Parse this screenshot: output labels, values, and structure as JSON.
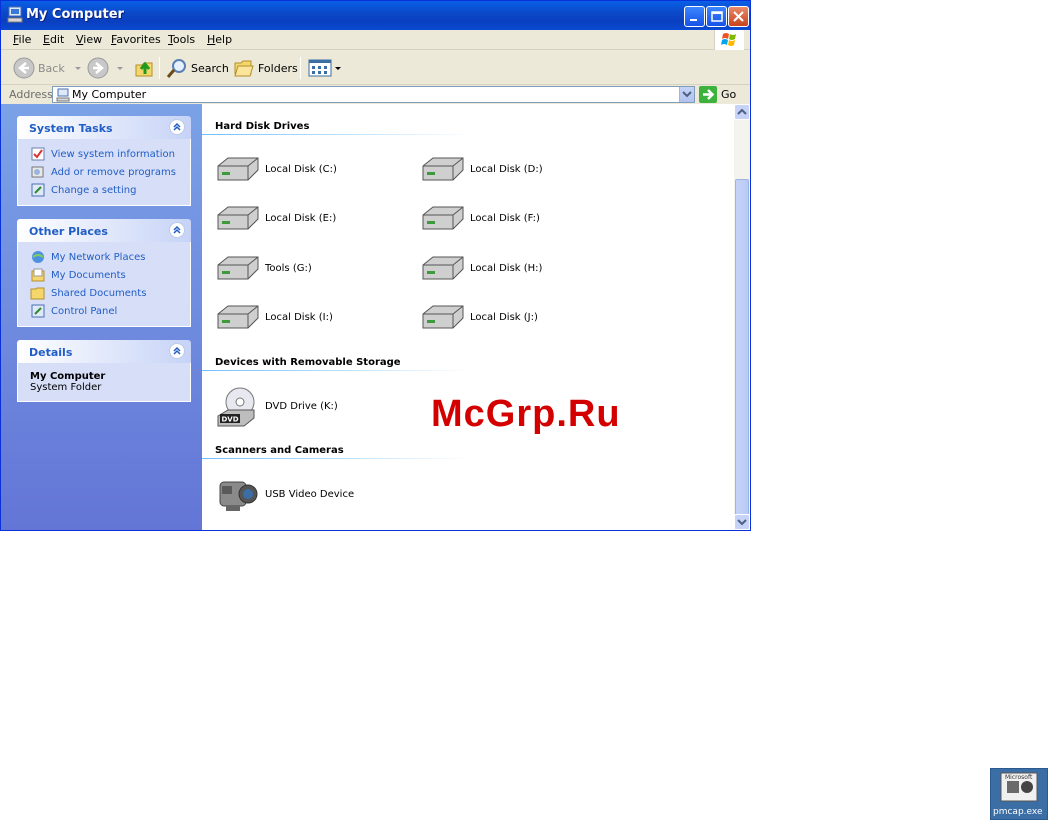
{
  "window": {
    "title": "My Computer"
  },
  "menu": [
    "File",
    "Edit",
    "View",
    "Favorites",
    "Tools",
    "Help"
  ],
  "toolbar": {
    "back_label": "Back",
    "search_label": "Search",
    "folders_label": "Folders"
  },
  "address": {
    "label": "Address",
    "value": "My Computer",
    "go_label": "Go"
  },
  "sidebar": {
    "system_tasks": {
      "title": "System Tasks",
      "items": [
        "View system information",
        "Add or remove programs",
        "Change a setting"
      ]
    },
    "other_places": {
      "title": "Other Places",
      "items": [
        "My Network Places",
        "My Documents",
        "Shared Documents",
        "Control Panel"
      ]
    },
    "details": {
      "title": "Details",
      "name": "My Computer",
      "type": "System Folder"
    }
  },
  "groups": {
    "hard_disks": {
      "title": "Hard Disk Drives",
      "items": [
        "Local Disk (C:)",
        "Local Disk (D:)",
        "Local Disk (E:)",
        "Local Disk (F:)",
        "Tools (G:)",
        "Local Disk (H:)",
        "Local Disk (I:)",
        "Local Disk (J:)"
      ]
    },
    "removable": {
      "title": "Devices with Removable Storage",
      "items": [
        "DVD Drive (K:)"
      ]
    },
    "scanners": {
      "title": "Scanners and Cameras",
      "items": [
        "USB Video Device"
      ]
    }
  },
  "watermark": "McGrp.Ru",
  "desktop_icon": {
    "label": "pmcap.exe",
    "caption": "Microsoft"
  },
  "colors": {
    "titlebar": "#0a49c9",
    "task_link": "#215dc6",
    "sidebar_bg": "#7ba2e7"
  }
}
